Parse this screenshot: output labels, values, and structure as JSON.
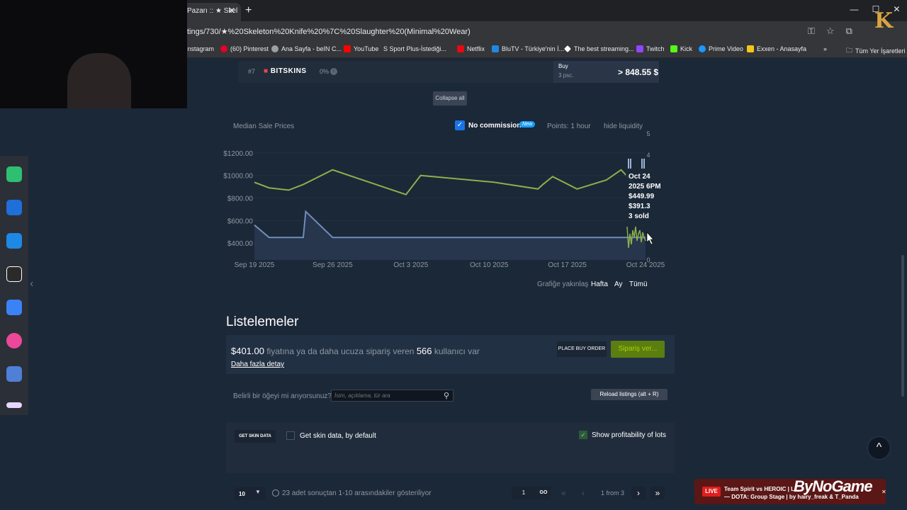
{
  "browser": {
    "tab_title": "Pazarı :: ★ Skel",
    "url": "tings/730/★%20Skeleton%20Knife%20%7C%20Slaughter%20(Minimal%20Wear)",
    "bookmarks": [
      {
        "label": "Instagram",
        "color": "#e1306c"
      },
      {
        "label": "(60) Pinterest",
        "color": "#e60023"
      },
      {
        "label": "Ana Sayfa - beIN C...",
        "color": "#5f2d82"
      },
      {
        "label": "YouTube",
        "color": "#ff0000"
      },
      {
        "label": "S Sport Plus-İstediği...",
        "color": "#111111"
      },
      {
        "label": "Netflix",
        "color": "#e50914"
      },
      {
        "label": "BluTV - Türkiye'nin İ...",
        "color": "#1e88e5"
      },
      {
        "label": "The best streaming...",
        "color": "#ffffff"
      },
      {
        "label": "Twitch",
        "color": "#9146ff"
      },
      {
        "label": "Kick",
        "color": "#53fc18"
      },
      {
        "label": "Prime Video",
        "color": "#1a98ff"
      },
      {
        "label": "Exxen - Anasayfa",
        "color": "#f5c518"
      }
    ],
    "all_bookmarks": "Tüm Yer İşaretleri"
  },
  "offers": {
    "rank": "#7",
    "site": "BITSKINS",
    "fee": "0%",
    "buy_label": "Buy",
    "buy_qty": "3 psc.",
    "buy_price": "> 848.55 $",
    "collapse_label": "Collapse all"
  },
  "chart_header": {
    "title": "Median Sale Prices",
    "no_commission": "No commission",
    "new_badge": "New",
    "points": "Points: 1 hour",
    "liquidity": "hide liquidity"
  },
  "chart_data": {
    "type": "line",
    "x": [
      "Sep 19 2025",
      "Sep 26 2025",
      "Oct 3 2025",
      "Oct 10 2025",
      "Oct 17 2025",
      "Oct 24 2025"
    ],
    "y_ticks": [
      "$1200.00",
      "$1000.00",
      "$800.00",
      "$600.00",
      "$400.00"
    ],
    "y_right_ticks": [
      "5",
      "4",
      "0"
    ],
    "ylim": [
      250,
      1300
    ],
    "series": [
      {
        "color": "#8bb04a",
        "values": [
          [
            0,
            940
          ],
          [
            3,
            890
          ],
          [
            7,
            870
          ],
          [
            10,
            920
          ],
          [
            16,
            1050
          ],
          [
            31,
            830
          ],
          [
            34,
            1000
          ],
          [
            49,
            940
          ],
          [
            58,
            880
          ],
          [
            59,
            920
          ],
          [
            61,
            990
          ],
          [
            66,
            880
          ],
          [
            72,
            960
          ],
          [
            75,
            1050
          ],
          [
            80,
            820
          ]
        ]
      },
      {
        "color": "#6f8db9",
        "values": [
          [
            0,
            560
          ],
          [
            3,
            450
          ],
          [
            10,
            450
          ],
          [
            10.5,
            680
          ],
          [
            16,
            450
          ],
          [
            80,
            450
          ]
        ]
      }
    ],
    "tooltip": {
      "date": "Oct 24",
      "time": "2025 6PM",
      "price1": "$449.99",
      "price2": "$391.3",
      "sold": "3 sold"
    },
    "zoom_label": "Grafiğe yakınlaş",
    "zoom_options": [
      "Hafta",
      "Ay",
      "Tümü"
    ]
  },
  "listings": {
    "heading": "Listelemeler",
    "order_price": "$401.00",
    "order_text_1": "fiyatına ya da daha ucuza sipariş veren",
    "order_count": "566",
    "order_text_2": "kullanıcı var",
    "more_detail": "Daha fazla detay",
    "place_buy_order": "PLACE BUY ORDER",
    "order_button": "Sipariş ver...",
    "search_label": "Belirli bir öğeyi mi arıyorsunuz?",
    "search_placeholder": "İsim, açıklama, tür ara",
    "reload": "Reload listings (alt + R)",
    "skin_data_btn": "GET SKIN DATA",
    "skin_default": "Get skin data, by default",
    "profitability": "Show profitability of lots",
    "per_page": "10",
    "results": "23 adet sonuçtan 1-10 arasındakiler gösteriliyor",
    "page_value": "1",
    "go": "GO",
    "page_info": "1 from 3"
  },
  "overlay": {
    "live": "LIVE",
    "title": "Team Spirit vs HEROIC | L...",
    "subtitle": "— DOTA: Group Stage | by hairy_freak & T_Panda",
    "brand": "ByNoGame"
  }
}
